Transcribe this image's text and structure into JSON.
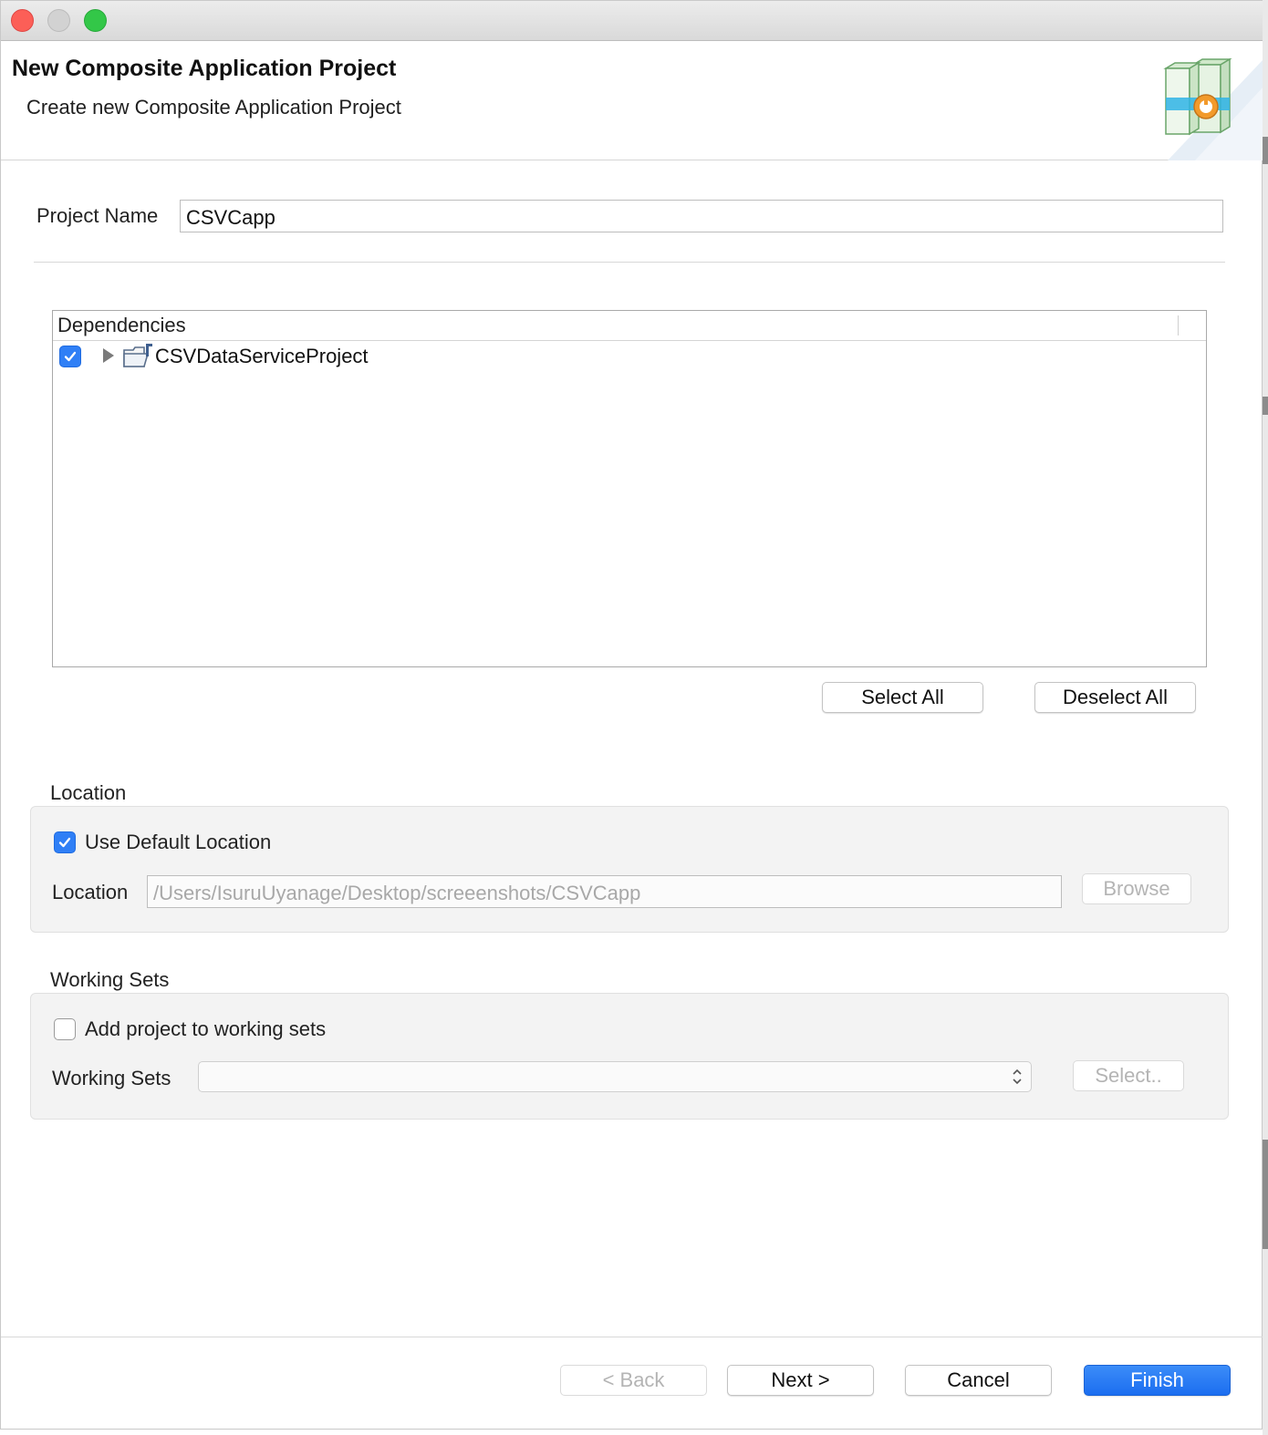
{
  "window": {
    "traffic_lights": [
      "close",
      "minimize",
      "maximize"
    ]
  },
  "banner": {
    "title": "New Composite Application Project",
    "subtitle": "Create new Composite Application Project",
    "icon": "composite-app-wizard-icon"
  },
  "project": {
    "label": "Project Name",
    "value": "CSVCapp"
  },
  "dependencies": {
    "header": "Dependencies",
    "items": [
      {
        "label": "CSVDataServiceProject",
        "checked": true,
        "icon": "folder-icon"
      }
    ],
    "select_all_label": "Select All",
    "deselect_all_label": "Deselect All"
  },
  "location": {
    "group_title": "Location",
    "use_default_label": "Use Default Location",
    "use_default_checked": true,
    "field_label": "Location",
    "path": "/Users/IsuruUyanage/Desktop/screeenshots/CSVCapp",
    "browse_label": "Browse"
  },
  "working_sets": {
    "group_title": "Working Sets",
    "add_label": "Add project to working sets",
    "add_checked": false,
    "field_label": "Working Sets",
    "selected": "",
    "select_label": "Select.."
  },
  "footer": {
    "back_label": "< Back",
    "next_label": "Next >",
    "cancel_label": "Cancel",
    "finish_label": "Finish"
  },
  "colors": {
    "accent": "#2f7ff6",
    "close": "#fc5f57",
    "maximize": "#33c748"
  }
}
